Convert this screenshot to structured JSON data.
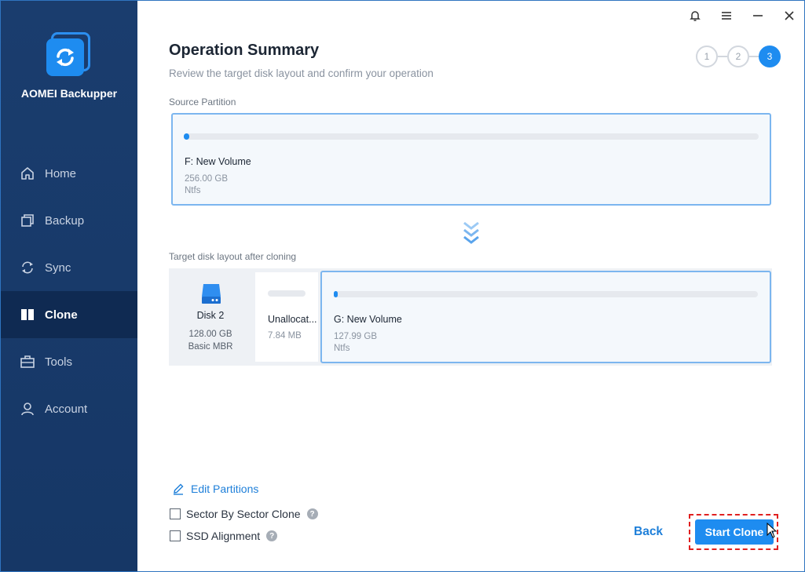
{
  "app": {
    "name": "AOMEI Backupper"
  },
  "sidebar": {
    "items": [
      {
        "label": "Home",
        "icon": "home-icon",
        "active": false
      },
      {
        "label": "Backup",
        "icon": "backup-icon",
        "active": false
      },
      {
        "label": "Sync",
        "icon": "sync-icon",
        "active": false
      },
      {
        "label": "Clone",
        "icon": "clone-icon",
        "active": true
      },
      {
        "label": "Tools",
        "icon": "tools-icon",
        "active": false
      },
      {
        "label": "Account",
        "icon": "account-icon",
        "active": false
      }
    ]
  },
  "window_controls": [
    "bell-icon",
    "menu-icon",
    "minimize-icon",
    "close-icon"
  ],
  "header": {
    "title": "Operation Summary",
    "subtitle": "Review the target disk layout and confirm your operation"
  },
  "steps": {
    "items": [
      "1",
      "2",
      "3"
    ],
    "current": 3
  },
  "source": {
    "label": "Source Partition",
    "volume_name": "F: New Volume",
    "size": "256.00 GB",
    "fs": "Ntfs",
    "used_fraction": 0.01
  },
  "target": {
    "label": "Target disk layout after cloning",
    "disk": {
      "name": "Disk 2",
      "size": "128.00 GB",
      "type": "Basic MBR"
    },
    "unallocated": {
      "name": "Unallocat...",
      "size": "7.84 MB"
    },
    "volume": {
      "name": "G: New Volume",
      "size": "127.99 GB",
      "fs": "Ntfs",
      "used_fraction": 0.01
    }
  },
  "options": {
    "edit_partitions": "Edit Partitions",
    "sector_by_sector": "Sector By Sector Clone",
    "ssd_alignment": "SSD Alignment",
    "help_glyph": "?"
  },
  "footer": {
    "back": "Back",
    "start": "Start Clone"
  },
  "colors": {
    "accent": "#1e8cf0",
    "sidebar": "#1a3d6e",
    "sidebar_active": "#0f2a52",
    "highlight": "#e02020"
  }
}
